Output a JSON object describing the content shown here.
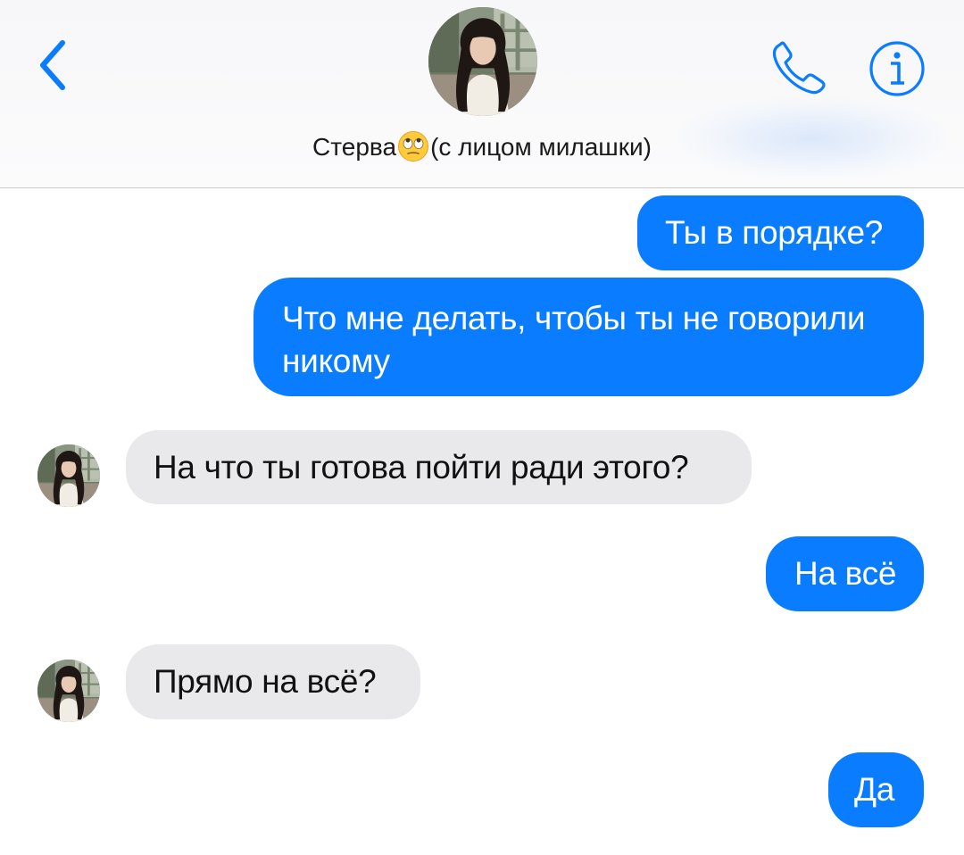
{
  "header": {
    "back_icon": "chevron-left-icon",
    "call_icon": "phone-icon",
    "info_icon": "info-icon",
    "contact_name_before": "Стерва",
    "contact_name_emoji": "eye-roll-emoji",
    "contact_name_after": "(с лицом милашки)",
    "accent_color": "#0a7cff"
  },
  "messages": [
    {
      "direction": "outgoing",
      "text": "Ты в порядке?"
    },
    {
      "direction": "outgoing",
      "text_line1": "Что мне делать, чтобы ты не говорили",
      "text_line2": "никому"
    },
    {
      "direction": "incoming",
      "text": "На что ты готова пойти ради этого?"
    },
    {
      "direction": "outgoing",
      "text": "На всё"
    },
    {
      "direction": "incoming",
      "text": "Прямо на всё?"
    },
    {
      "direction": "outgoing",
      "text": "Да"
    }
  ],
  "colors": {
    "outgoing_bubble": "#0a7cff",
    "incoming_bubble": "#e9e9eb",
    "outgoing_text": "#ffffff",
    "incoming_text": "#111111"
  }
}
